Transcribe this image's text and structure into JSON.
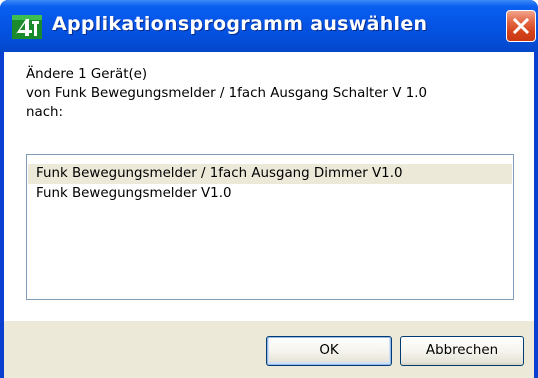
{
  "window": {
    "title": "Applikationsprogramm auswählen",
    "icon": "ets-app-icon",
    "close_icon": "close-icon"
  },
  "message": {
    "line1": "Ändere 1 Gerät(e)",
    "line2": "von Funk Bewegungsmelder / 1fach Ausgang Schalter V 1.0",
    "line3": "nach:"
  },
  "list": {
    "items": [
      {
        "label": "Funk Bewegungsmelder / 1fach Ausgang Dimmer V1.0",
        "selected": true
      },
      {
        "label": "Funk Bewegungsmelder V1.0",
        "selected": false
      }
    ]
  },
  "buttons": {
    "ok_label": "OK",
    "cancel_label": "Abbrechen"
  },
  "colors": {
    "titlebar": "#0656e8",
    "close": "#d4421a",
    "dialog_face": "#ece9d8",
    "selection": "#ece9d8"
  }
}
